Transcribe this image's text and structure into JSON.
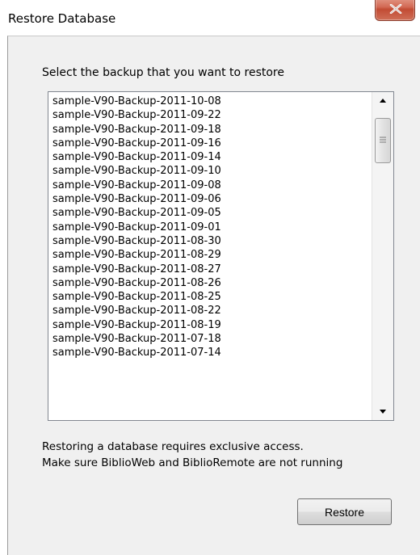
{
  "window": {
    "title": "Restore Database"
  },
  "dialog": {
    "prompt": "Select the backup that you want to restore",
    "backups": [
      "sample-V90-Backup-2011-10-08",
      "sample-V90-Backup-2011-09-22",
      "sample-V90-Backup-2011-09-18",
      "sample-V90-Backup-2011-09-16",
      "sample-V90-Backup-2011-09-14",
      "sample-V90-Backup-2011-09-10",
      "sample-V90-Backup-2011-09-08",
      "sample-V90-Backup-2011-09-06",
      "sample-V90-Backup-2011-09-05",
      "sample-V90-Backup-2011-09-01",
      "sample-V90-Backup-2011-08-30",
      "sample-V90-Backup-2011-08-29",
      "sample-V90-Backup-2011-08-27",
      "sample-V90-Backup-2011-08-26",
      "sample-V90-Backup-2011-08-25",
      "sample-V90-Backup-2011-08-22",
      "sample-V90-Backup-2011-08-19",
      "sample-V90-Backup-2011-07-18",
      "sample-V90-Backup-2011-07-14"
    ],
    "notice_line1": "Restoring a database requires exclusive access.",
    "notice_line2": "Make sure BiblioWeb and BiblioRemote are not running",
    "restore_label": "Restore"
  },
  "icons": {
    "close": "close-icon",
    "scroll_up": "arrow-up-icon",
    "scroll_down": "arrow-down-icon",
    "thumb_grip": "grip-icon"
  },
  "colors": {
    "close_button": "#c9553e",
    "dialog_background": "#f0f0f0",
    "list_border": "#828790"
  }
}
